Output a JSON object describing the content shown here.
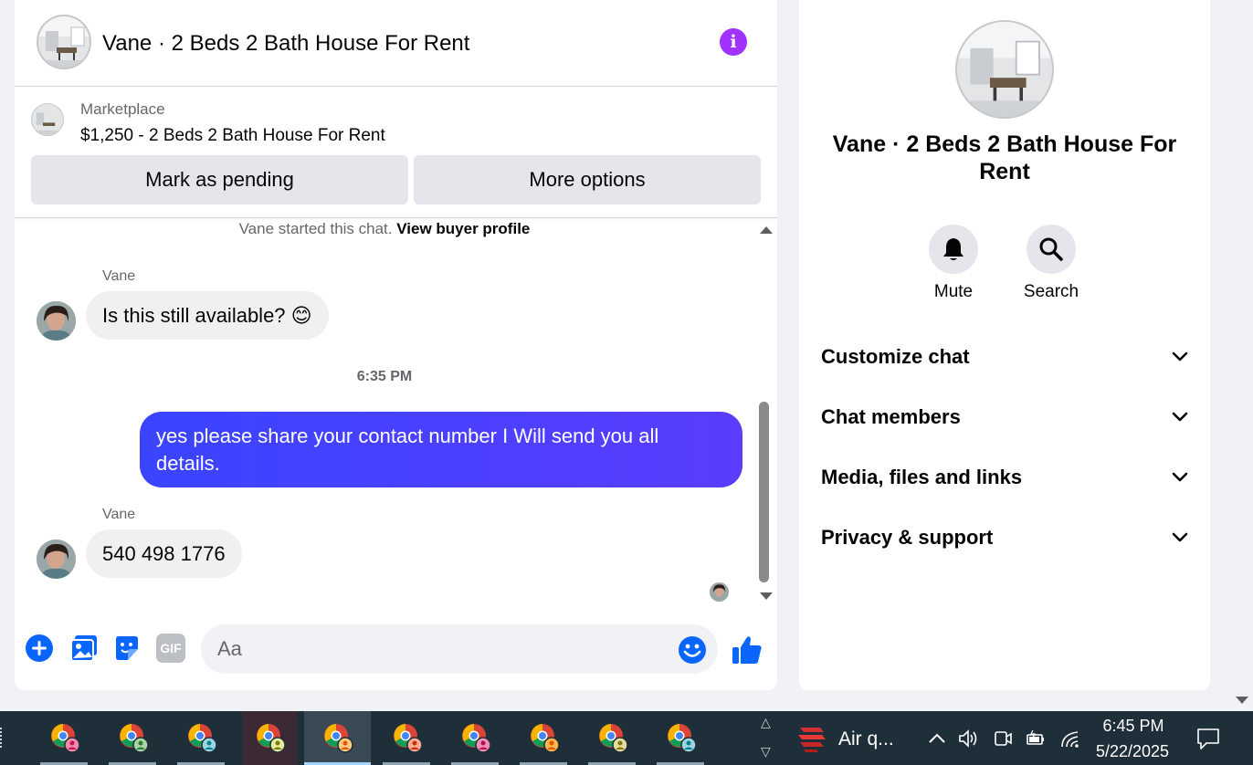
{
  "header": {
    "title": "Vane · 2 Beds 2 Bath House For Rent"
  },
  "listing": {
    "category": "Marketplace",
    "price_title": "$1,250 - 2 Beds 2 Bath House For Rent",
    "pending_label": "Mark as pending",
    "more_label": "More options"
  },
  "thread": {
    "system_text": "Vane started this chat.",
    "system_link": "View buyer profile",
    "messages": [
      {
        "sender": "Vane",
        "text": "Is this still available? 😊",
        "direction": "incoming"
      },
      {
        "timestamp": "6:35 PM"
      },
      {
        "text": "yes please share your contact number I Will send you all details.",
        "direction": "outgoing"
      },
      {
        "sender": "Vane",
        "text": "540 498 1776",
        "direction": "incoming"
      }
    ]
  },
  "composer": {
    "placeholder": "Aa",
    "gif_label": "GIF"
  },
  "details": {
    "title": "Vane · 2 Beds 2 Bath House For Rent",
    "actions": [
      {
        "label": "Mute",
        "icon": "bell-icon"
      },
      {
        "label": "Search",
        "icon": "search-icon"
      }
    ],
    "sections": [
      {
        "label": "Customize chat"
      },
      {
        "label": "Chat members"
      },
      {
        "label": "Media, files and links"
      },
      {
        "label": "Privacy & support"
      }
    ]
  },
  "taskbar": {
    "widget_label": "Air q...",
    "time": "6:45 PM",
    "date": "5/22/2025"
  },
  "colors": {
    "accent": "#0866ff",
    "outgoing_bubble": "#4541ff",
    "info_icon": "#a033ff",
    "taskbar": "#1f2f3a"
  }
}
